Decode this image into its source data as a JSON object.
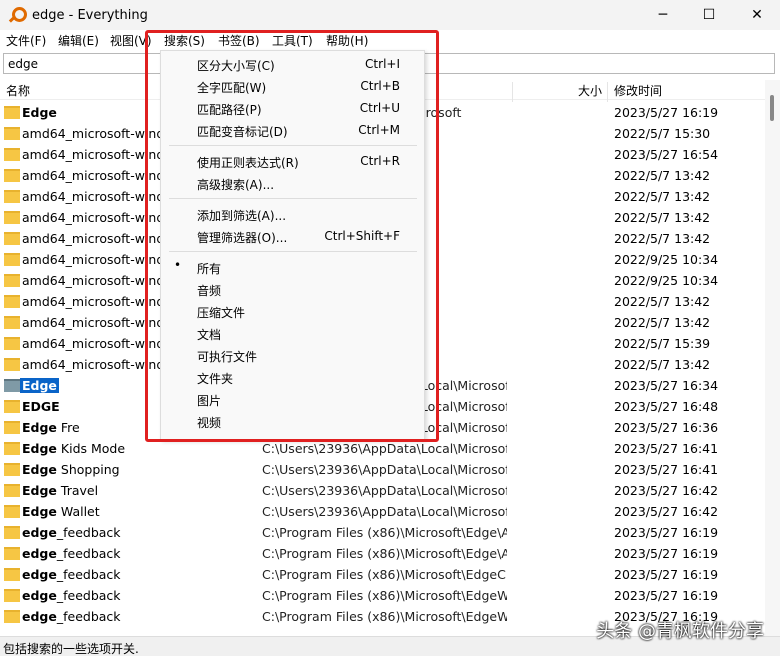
{
  "window": {
    "title": "edge - Everything",
    "minimize": "─",
    "maximize": "☐",
    "close": "✕"
  },
  "menubar": [
    "文件(F)",
    "编辑(E)",
    "视图(V)",
    "搜索(S)",
    "书签(B)",
    "工具(T)",
    "帮助(H)"
  ],
  "search": {
    "value": "edge"
  },
  "columns": {
    "name": "名称",
    "size": "大小",
    "modified": "修改时间"
  },
  "rows": [
    {
      "bold": "Edge",
      "rest": "",
      "path": "C:\\Program Files (x86)\\Microsoft",
      "date": "2023/5/27 16:19"
    },
    {
      "bold": "",
      "rest": "amd64_microsoft-windo",
      "path": "",
      "date": "2022/5/7 15:30"
    },
    {
      "bold": "",
      "rest": "amd64_microsoft-windo",
      "path": "",
      "date": "2023/5/27 16:54"
    },
    {
      "bold": "",
      "rest": "amd64_microsoft-windo",
      "path": "",
      "date": "2022/5/7 13:42"
    },
    {
      "bold": "",
      "rest": "amd64_microsoft-windo",
      "path": "",
      "date": "2022/5/7 13:42"
    },
    {
      "bold": "",
      "rest": "amd64_microsoft-windo",
      "path": "",
      "date": "2022/5/7 13:42"
    },
    {
      "bold": "",
      "rest": "amd64_microsoft-windo",
      "path": "",
      "date": "2022/5/7 13:42"
    },
    {
      "bold": "",
      "rest": "amd64_microsoft-windo",
      "path": "",
      "date": "2022/9/25 10:34"
    },
    {
      "bold": "",
      "rest": "amd64_microsoft-windo",
      "path": "",
      "date": "2022/9/25 10:34"
    },
    {
      "bold": "",
      "rest": "amd64_microsoft-windo",
      "path": "",
      "date": "2022/5/7 13:42"
    },
    {
      "bold": "",
      "rest": "amd64_microsoft-windo",
      "path": "",
      "date": "2022/5/7 13:42"
    },
    {
      "bold": "",
      "rest": "amd64_microsoft-windo",
      "path": "",
      "date": "2022/5/7 15:39"
    },
    {
      "bold": "",
      "rest": "amd64_microsoft-windo",
      "path": "",
      "date": "2022/5/7 13:42"
    },
    {
      "bold": "Edge",
      "rest": "",
      "path": "C:\\Users\\23936\\AppData\\Local\\Microsoft",
      "date": "2023/5/27 16:34",
      "selected": true
    },
    {
      "bold": "EDGE",
      "rest": "",
      "path": "C:\\Users\\23936\\AppData\\Local\\Microsof...",
      "date": "2023/5/27 16:48"
    },
    {
      "bold": "Edge",
      "rest": " Fre",
      "path": "C:\\Users\\23936\\AppData\\Local\\Microsof...",
      "date": "2023/5/27 16:36"
    },
    {
      "bold": "Edge",
      "rest": " Kids Mode",
      "path": "C:\\Users\\23936\\AppData\\Local\\Microsof...",
      "date": "2023/5/27 16:41"
    },
    {
      "bold": "Edge",
      "rest": " Shopping",
      "path": "C:\\Users\\23936\\AppData\\Local\\Microsof...",
      "date": "2023/5/27 16:41"
    },
    {
      "bold": "Edge",
      "rest": " Travel",
      "path": "C:\\Users\\23936\\AppData\\Local\\Microsof...",
      "date": "2023/5/27 16:42"
    },
    {
      "bold": "Edge",
      "rest": " Wallet",
      "path": "C:\\Users\\23936\\AppData\\Local\\Microsof...",
      "date": "2023/5/27 16:42"
    },
    {
      "bold": "edge",
      "rest": "_feedback",
      "path": "C:\\Program Files (x86)\\Microsoft\\Edge\\A...",
      "date": "2023/5/27 16:19"
    },
    {
      "bold": "edge",
      "rest": "_feedback",
      "path": "C:\\Program Files (x86)\\Microsoft\\Edge\\A...",
      "date": "2023/5/27 16:19"
    },
    {
      "bold": "edge",
      "rest": "_feedback",
      "path": "C:\\Program Files (x86)\\Microsoft\\EdgeC...",
      "date": "2023/5/27 16:19"
    },
    {
      "bold": "edge",
      "rest": "_feedback",
      "path": "C:\\Program Files (x86)\\Microsoft\\EdgeW...",
      "date": "2023/5/27 16:19"
    },
    {
      "bold": "edge",
      "rest": "_feedback",
      "path": "C:\\Program Files (x86)\\Microsoft\\EdgeW...",
      "date": "2023/5/27 16:19"
    }
  ],
  "search_menu": {
    "groups": [
      [
        {
          "label": "区分大小写(C)",
          "shortcut": "Ctrl+I"
        },
        {
          "label": "全字匹配(W)",
          "shortcut": "Ctrl+B"
        },
        {
          "label": "匹配路径(P)",
          "shortcut": "Ctrl+U"
        },
        {
          "label": "匹配变音标记(D)",
          "shortcut": "Ctrl+M"
        }
      ],
      [
        {
          "label": "使用正则表达式(R)",
          "shortcut": "Ctrl+R"
        },
        {
          "label": "高级搜索(A)...",
          "shortcut": ""
        }
      ],
      [
        {
          "label": "添加到筛选(A)...",
          "shortcut": ""
        },
        {
          "label": "管理筛选器(O)...",
          "shortcut": "Ctrl+Shift+F"
        }
      ],
      [
        {
          "label": "所有",
          "shortcut": "",
          "checked": true
        },
        {
          "label": "音频",
          "shortcut": ""
        },
        {
          "label": "压缩文件",
          "shortcut": ""
        },
        {
          "label": "文档",
          "shortcut": ""
        },
        {
          "label": "可执行文件",
          "shortcut": ""
        },
        {
          "label": "文件夹",
          "shortcut": ""
        },
        {
          "label": "图片",
          "shortcut": ""
        },
        {
          "label": "视频",
          "shortcut": ""
        }
      ]
    ]
  },
  "status": "包括搜索的一些选项开关.",
  "watermark": "头条 @青枫软件分享",
  "colors": {
    "highlight": "#e02020",
    "selection": "#0a64c8"
  }
}
